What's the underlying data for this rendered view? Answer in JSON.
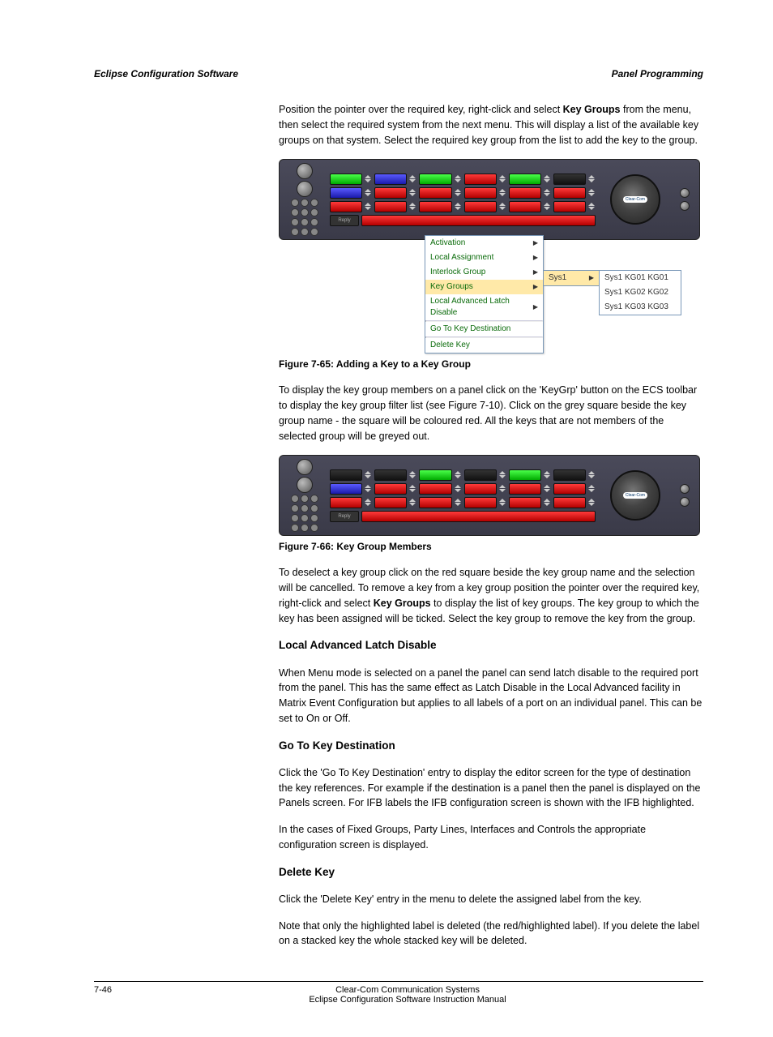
{
  "header": {
    "title": "Eclipse Configuration Software",
    "subtitle": "Panel Programming"
  },
  "para1a": "Position the pointer over the required key, right-click and select ",
  "para1b": "Key Groups",
  "para1c": " from the menu, then select the required system from the next menu. This will display a list of the available key groups on that system. Select the required key group from the list to add the key to the group.",
  "figure1": {
    "speaker_badge": "Clear-Com",
    "reply": "Reply",
    "menu": {
      "items": [
        "Activation",
        "Local Assignment",
        "Interlock Group",
        "Key Groups",
        "Local Advanced Latch Disable",
        "Go To Key Destination",
        "Delete Key"
      ],
      "selected_index": 3,
      "sub1": {
        "label": "Sys1"
      },
      "sub2": [
        "Sys1 KG01 KG01",
        "Sys1 KG02 KG02",
        "Sys1 KG03 KG03"
      ]
    },
    "caption": "Figure 7-65: Adding a Key to a Key Group"
  },
  "para2": "To display the key group members on a panel click on the 'KeyGrp' button on the ECS toolbar to display the key group filter list (see Figure 7-10). Click on the grey square beside the key group name - the square will be coloured red. All the keys that are not members of the selected group will be greyed out.",
  "figure2": {
    "speaker_badge": "Clear-Com",
    "reply": "Reply",
    "caption": "Figure 7-66: Key Group Members"
  },
  "para3a": "To deselect a key group click on the red square beside the key group name and the selection will be cancelled. To remove a key from a key group position the pointer over the required key, right-click and select ",
  "para3b": "Key Groups",
  "para3c": " to display the list of key groups. The key group to which the key has been assigned will be ticked. Select the key group to remove the key from the group.",
  "h_ladvlatch": "Local Advanced Latch Disable",
  "para_latch": "When Menu mode is selected on a panel the panel can send latch disable to the required port from the panel. This has the same effect as Latch Disable in the Local Advanced facility in Matrix Event Configuration but applies to all labels of a port on an individual panel. This can be set to On or Off.",
  "h_goto": "Go To Key Destination",
  "para_goto1": "Click the 'Go To Key Destination' entry to display the editor screen for the type of destination the key references. For example if the destination is a panel then the panel is displayed on the Panels screen. For IFB labels the IFB configuration screen is shown with the IFB highlighted.",
  "para_goto2": "In the cases of Fixed Groups, Party Lines, Interfaces and Controls the appropriate configuration screen is displayed.",
  "h_delete": "Delete Key",
  "para_delete": "Click the 'Delete Key' entry in the menu to delete the assigned label from the key.",
  "para_note": "Note that only the highlighted label is deleted (the red/highlighted label). If you delete the label on a stacked key the whole stacked key will be deleted.",
  "footer": {
    "left": "7-46",
    "center": "Clear-Com Communication Systems\nEclipse Configuration Software Instruction Manual",
    "right": ""
  }
}
